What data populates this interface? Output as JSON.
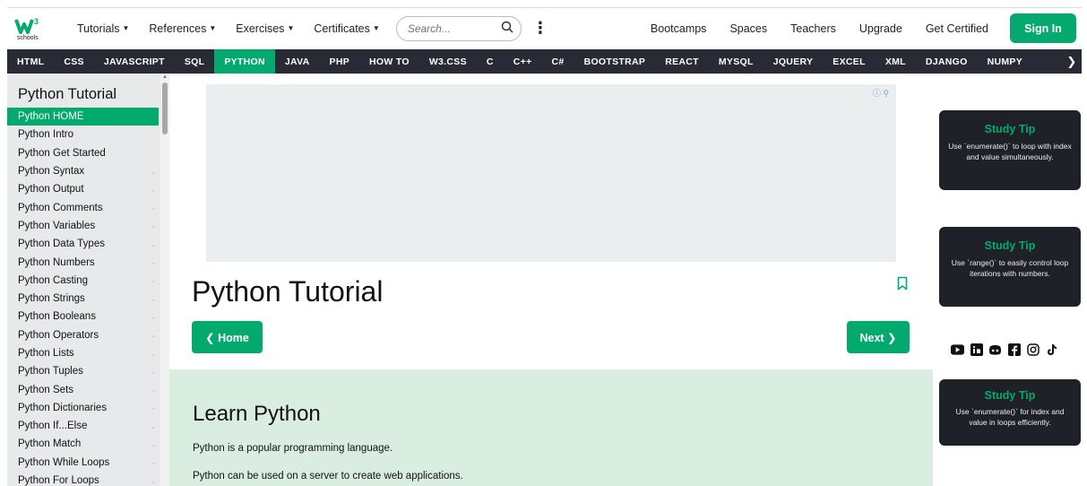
{
  "logo": {
    "sub": "schools"
  },
  "topnav": {
    "menus": [
      {
        "label": "Tutorials"
      },
      {
        "label": "References"
      },
      {
        "label": "Exercises"
      },
      {
        "label": "Certificates"
      }
    ],
    "search_placeholder": "Search...",
    "links": [
      "Bootcamps",
      "Spaces",
      "Teachers",
      "Upgrade",
      "Get Certified"
    ],
    "signin": "Sign In"
  },
  "subjects": {
    "items": [
      "HTML",
      "CSS",
      "JAVASCRIPT",
      "SQL",
      "PYTHON",
      "JAVA",
      "PHP",
      "HOW TO",
      "W3.CSS",
      "C",
      "C++",
      "C#",
      "BOOTSTRAP",
      "REACT",
      "MYSQL",
      "JQUERY",
      "EXCEL",
      "XML",
      "DJANGO",
      "NUMPY"
    ],
    "active": "PYTHON"
  },
  "sidebar": {
    "title": "Python Tutorial",
    "items": [
      "Python HOME",
      "Python Intro",
      "Python Get Started",
      "Python Syntax",
      "Python Output",
      "Python Comments",
      "Python Variables",
      "Python Data Types",
      "Python Numbers",
      "Python Casting",
      "Python Strings",
      "Python Booleans",
      "Python Operators",
      "Python Lists",
      "Python Tuples",
      "Python Sets",
      "Python Dictionaries",
      "Python If...Else",
      "Python Match",
      "Python While Loops",
      "Python For Loops"
    ]
  },
  "main": {
    "title": "Python Tutorial",
    "home_button": "❮ Home",
    "next_button": "Next ❯",
    "learn": {
      "heading": "Learn Python",
      "p1": "Python is a popular programming language.",
      "p2": "Python can be used on a server to create web applications."
    }
  },
  "tips": [
    {
      "title": "Study Tip",
      "body": "Use `enumerate()` to loop with index and value simultaneously."
    },
    {
      "title": "Study Tip",
      "body": "Use `range()` to easily control loop iterations with numbers."
    },
    {
      "title": "Study Tip",
      "body": "Use `enumerate()` for index and value in loops efficiently."
    }
  ],
  "colors": {
    "accent": "#04AA6D",
    "subjectbar": "#282A35",
    "sidebar": "#E7E9EB",
    "tip_bg": "#1E2128"
  }
}
